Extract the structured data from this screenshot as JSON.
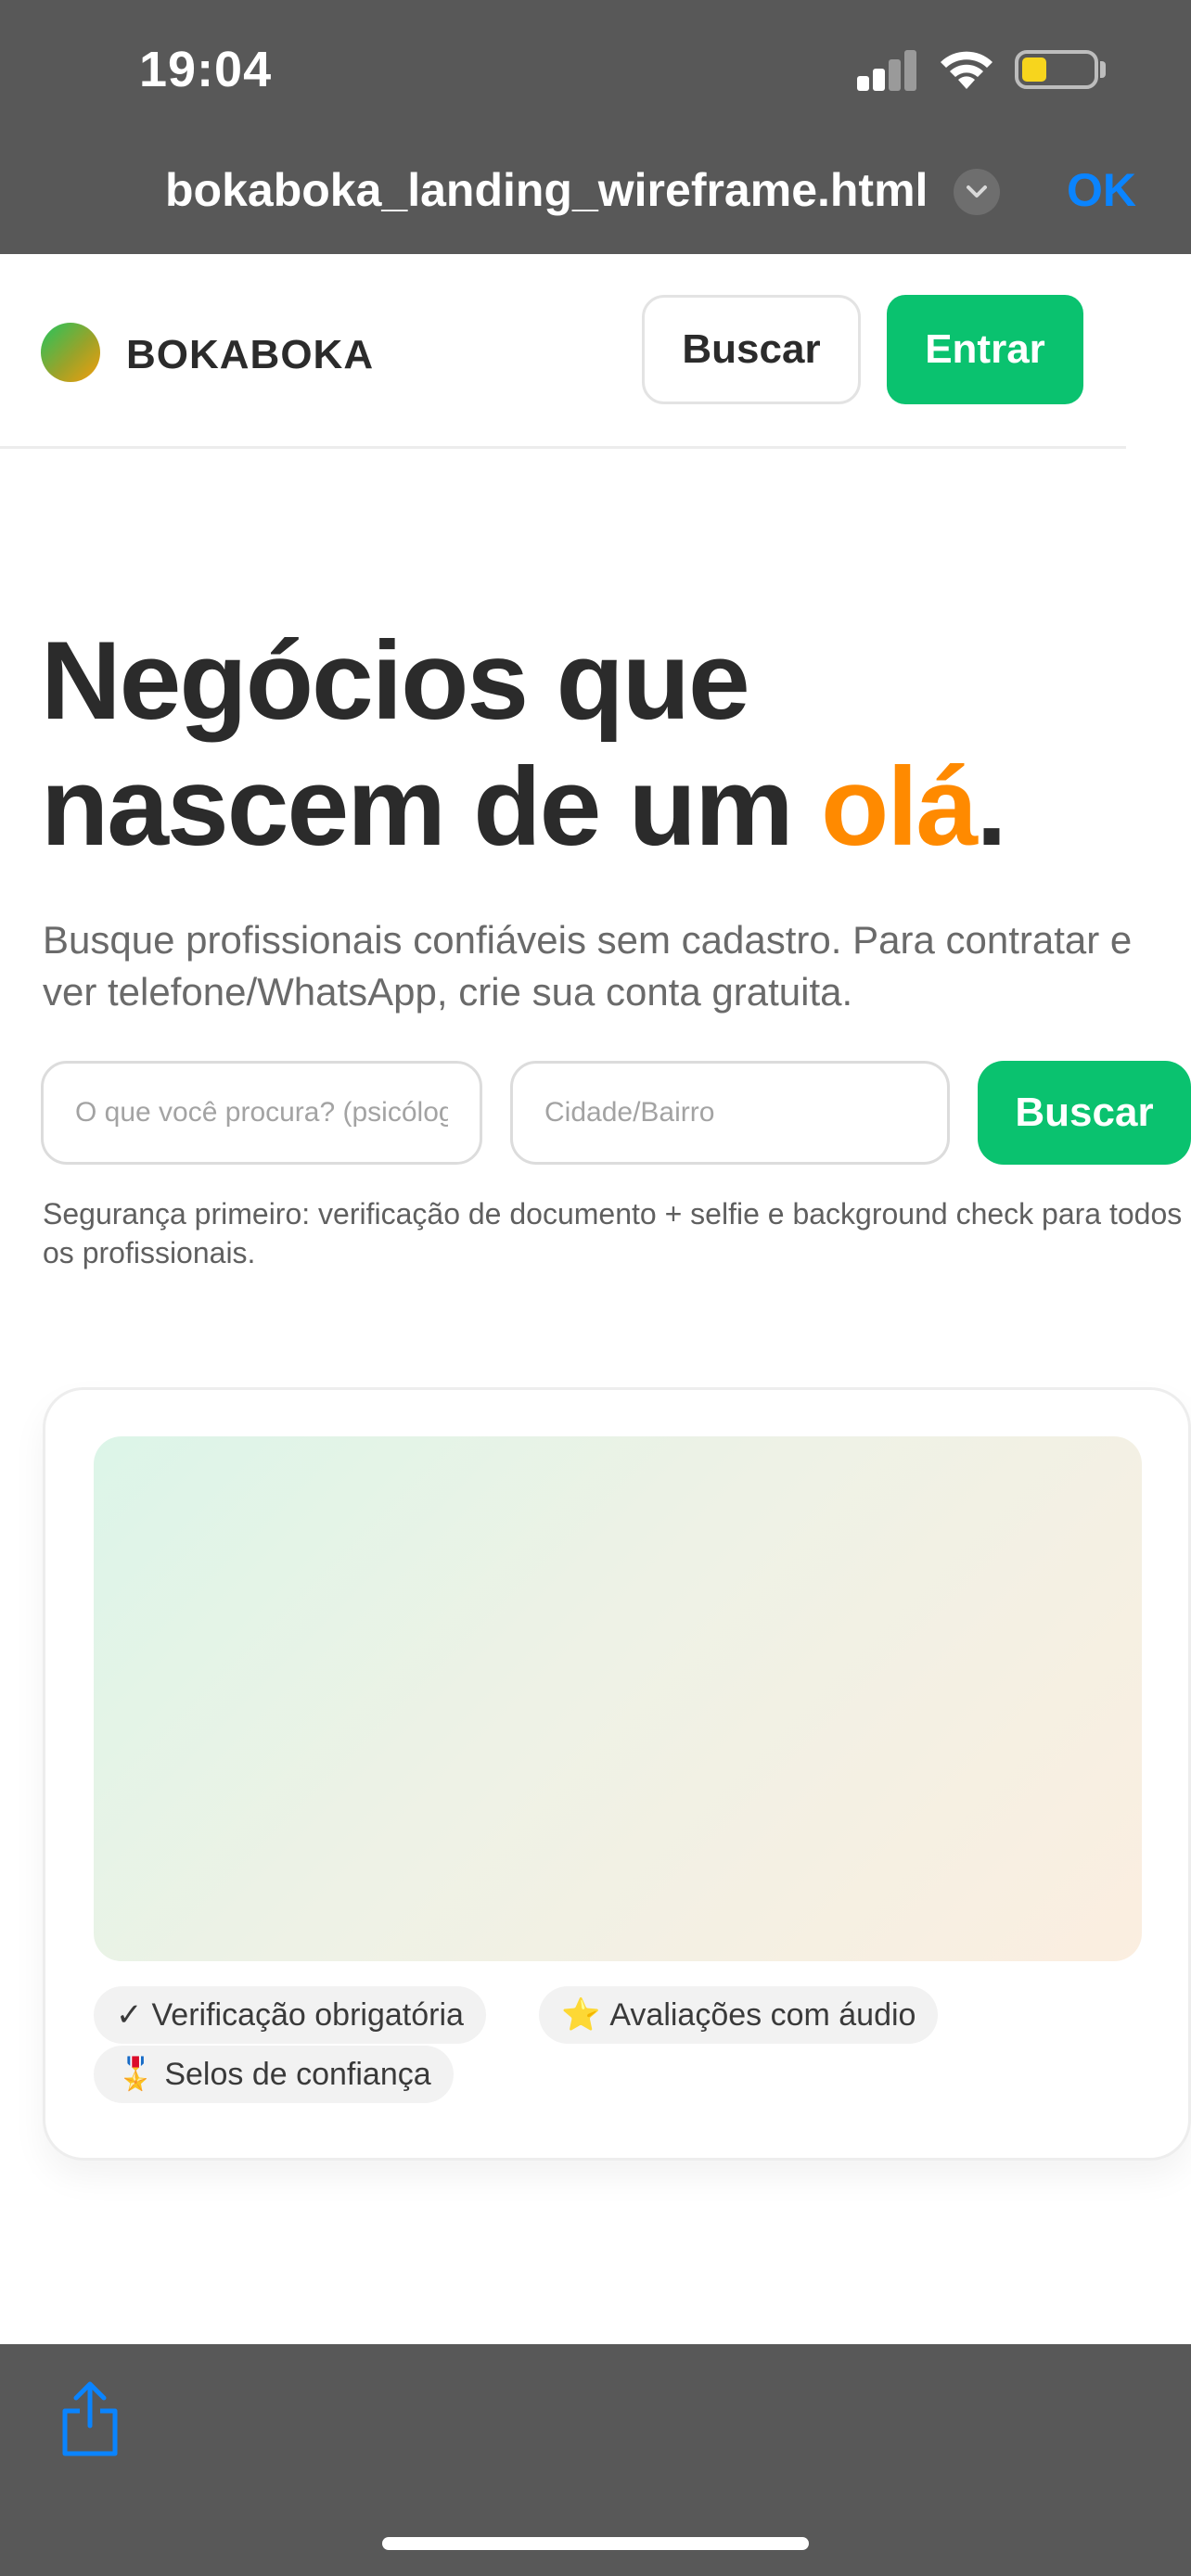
{
  "status_bar": {
    "time": "19:04",
    "battery_level": 0.35,
    "battery_color": "#f7d51d"
  },
  "quick_look": {
    "file_name": "bokaboka_landing_wireframe.html",
    "done_label": "OK",
    "done_color": "#0a84ff"
  },
  "nav": {
    "brand": "BOKABOKA",
    "search_label": "Buscar",
    "login_label": "Entrar"
  },
  "hero": {
    "title_line1": "Negócios que",
    "title_line2_prefix": "nascem de um ",
    "title_accent": "olá",
    "title_suffix": ".",
    "accent_color": "#ff8a00",
    "subtitle": "Busque profissionais confiáveis sem cadastro. Para contratar e ver telefone/WhatsApp, crie sua conta gratuita."
  },
  "search": {
    "what_placeholder": "O que você procura? (psicólogo, eletricista...)",
    "city_placeholder": "Cidade/Bairro",
    "button_label": "Buscar",
    "button_color": "#0ac26f"
  },
  "safety_note": "Segurança primeiro: verificação de documento + selfie e background check para todos os profissionais.",
  "card": {
    "chips": [
      {
        "icon": "✓",
        "icon_name": "check-icon",
        "label": "Verificação obrigatória"
      },
      {
        "icon": "⭐",
        "icon_name": "star-icon",
        "label": "Avaliações com áudio"
      },
      {
        "icon": "🎖️",
        "icon_name": "medal-icon",
        "label": "Selos de confiança"
      }
    ]
  },
  "toolbar": {
    "share_icon": "share-icon"
  }
}
